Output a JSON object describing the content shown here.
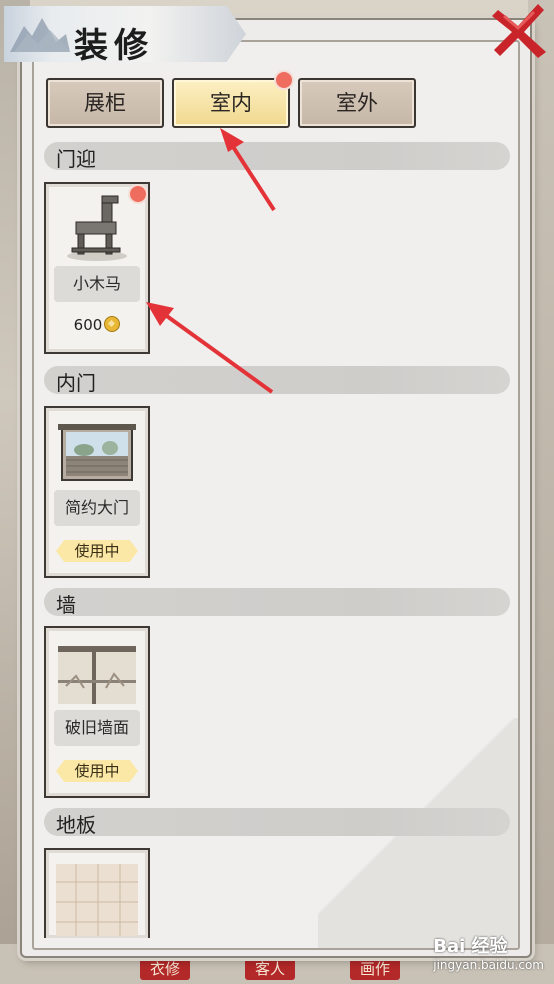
{
  "title": "装修",
  "tabs": [
    {
      "label": "展柜",
      "active": false
    },
    {
      "label": "室内",
      "active": true,
      "badge": true
    },
    {
      "label": "室外",
      "active": false
    }
  ],
  "sections": [
    {
      "label": "门迎",
      "items": [
        {
          "name": "小木马",
          "price": "600",
          "status": ""
        }
      ]
    },
    {
      "label": "内门",
      "items": [
        {
          "name": "简约大门",
          "price": "",
          "status": "使用中"
        }
      ]
    },
    {
      "label": "墙",
      "items": [
        {
          "name": "破旧墙面",
          "price": "",
          "status": "使用中"
        }
      ]
    },
    {
      "label": "地板",
      "items": [
        {
          "name": "",
          "price": "",
          "status": ""
        }
      ]
    }
  ],
  "bottom_nav": [
    "衣修",
    "客人",
    "画作"
  ],
  "watermark": {
    "logo": "Bai 经验",
    "url": "jingyan.baidu.com"
  },
  "colors": {
    "accent_red": "#b32828",
    "active_tab": "#f0d88e",
    "badge": "#ef6d5e"
  }
}
